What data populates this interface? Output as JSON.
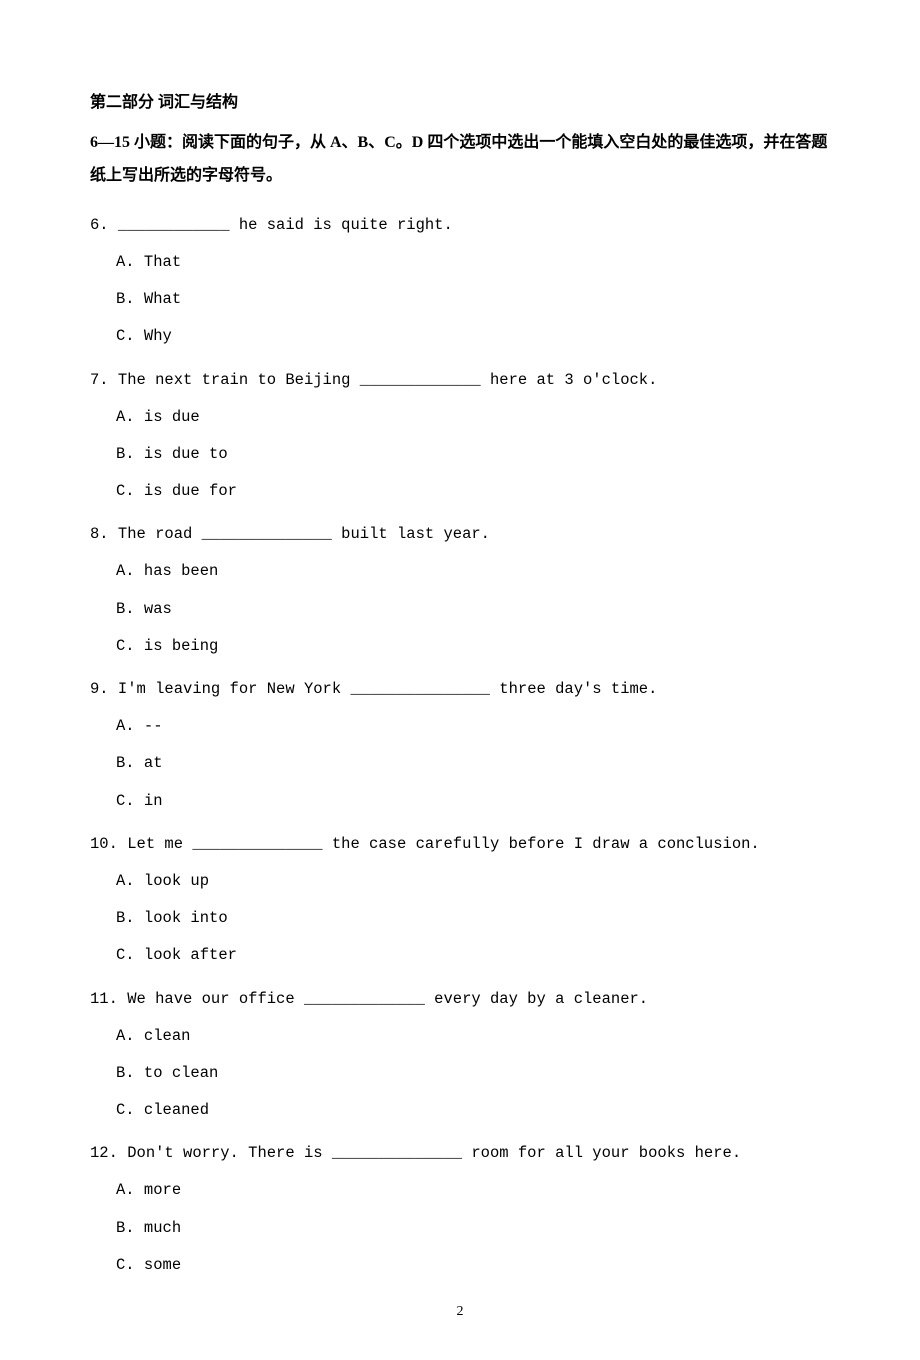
{
  "header": {
    "section_title": "第二部分  词汇与结构"
  },
  "instructions": "6—15 小题：阅读下面的句子，从 A、B、C。D 四个选项中选出一个能填入空白处的最佳选项，并在答题纸上写出所选的字母符号。",
  "questions": [
    {
      "num": "6.",
      "stem": "____________ he said is quite right.",
      "options": [
        {
          "label": "A.",
          "text": "That"
        },
        {
          "label": "B.",
          "text": "What"
        },
        {
          "label": "C.",
          "text": "Why"
        }
      ]
    },
    {
      "num": "7.",
      "stem": "The next train to Beijing _____________ here at 3 o'clock.",
      "options": [
        {
          "label": "A.",
          "text": "is due"
        },
        {
          "label": "B.",
          "text": "is due to"
        },
        {
          "label": "C.",
          "text": "is due for"
        }
      ]
    },
    {
      "num": "8.",
      "stem": "The road ______________ built last year.",
      "options": [
        {
          "label": "A.",
          "text": "has been"
        },
        {
          "label": "B.",
          "text": "was"
        },
        {
          "label": "C.",
          "text": "is being"
        }
      ]
    },
    {
      "num": "9.",
      "stem": "I'm leaving for New York _______________ three day's time.",
      "options": [
        {
          "label": "A.",
          "text": "--"
        },
        {
          "label": "B.",
          "text": "at"
        },
        {
          "label": "C.",
          "text": "in"
        }
      ]
    },
    {
      "num": "10.",
      "stem": "Let me ______________ the case carefully before I draw a conclusion.",
      "options": [
        {
          "label": "A.",
          "text": "look up"
        },
        {
          "label": "B.",
          "text": "look into"
        },
        {
          "label": "C.",
          "text": "look after"
        }
      ]
    },
    {
      "num": "11.",
      "stem": "We have our office _____________ every day by a cleaner.",
      "options": [
        {
          "label": "A.",
          "text": "clean"
        },
        {
          "label": "B.",
          "text": "to clean"
        },
        {
          "label": "C.",
          "text": "cleaned"
        }
      ]
    },
    {
      "num": "12.",
      "stem": "Don't worry. There is ______________ room for all your books here.",
      "options": [
        {
          "label": "A.",
          "text": "more"
        },
        {
          "label": "B.",
          "text": "much"
        },
        {
          "label": "C.",
          "text": "some"
        }
      ]
    }
  ],
  "page_number": "2"
}
